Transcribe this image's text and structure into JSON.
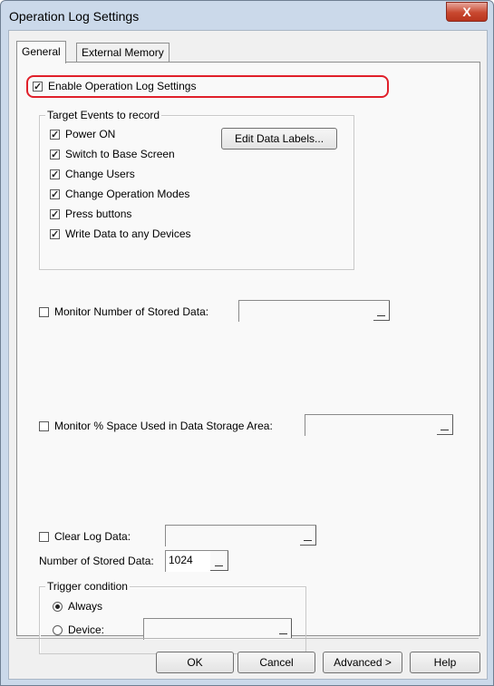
{
  "window": {
    "title": "Operation Log Settings",
    "close_label": "X"
  },
  "tabs": [
    {
      "label": "General",
      "active": true
    },
    {
      "label": "External Memory",
      "active": false
    }
  ],
  "enable_log": {
    "label": "Enable Operation Log Settings",
    "checked": true
  },
  "target_events": {
    "group_label": "Target Events to record",
    "edit_button_label": "Edit Data Labels...",
    "items": [
      {
        "label": "Power ON",
        "checked": true
      },
      {
        "label": "Switch to Base Screen",
        "checked": true
      },
      {
        "label": "Change Users",
        "checked": true
      },
      {
        "label": "Change Operation Modes",
        "checked": true
      },
      {
        "label": "Press buttons",
        "checked": true
      },
      {
        "label": "Write Data to any Devices",
        "checked": true
      }
    ]
  },
  "monitor_stored": {
    "label": "Monitor Number of Stored Data:",
    "checked": false,
    "value": ""
  },
  "monitor_space": {
    "label": "Monitor % Space Used in Data Storage Area:",
    "checked": false,
    "value": ""
  },
  "clear_log": {
    "label": "Clear Log Data:",
    "checked": false,
    "value": ""
  },
  "stored_data": {
    "label": "Number of Stored Data:",
    "value": "1024"
  },
  "trigger": {
    "group_label": "Trigger condition",
    "always_label": "Always",
    "always_selected": true,
    "device_label": "Device:",
    "device_selected": false,
    "device_value": ""
  },
  "buttons": {
    "ok": "OK",
    "cancel": "Cancel",
    "advanced": "Advanced >",
    "help": "Help"
  },
  "colors": {
    "highlight": "#e0202a",
    "close_button": "#c9482f",
    "frame": "#cbd9ea"
  }
}
